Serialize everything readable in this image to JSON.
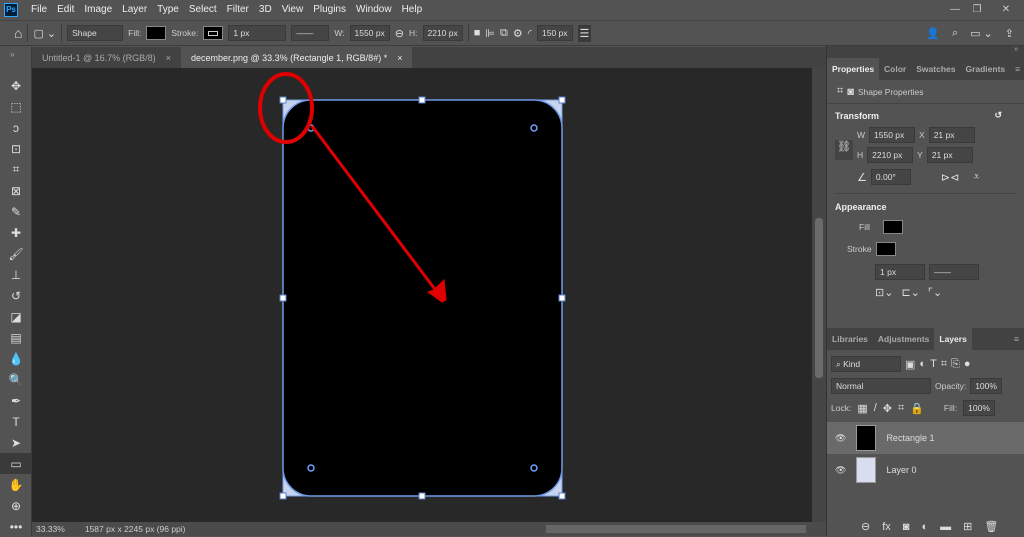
{
  "app": {
    "logo": "Ps",
    "menu": [
      "File",
      "Edit",
      "Image",
      "Layer",
      "Type",
      "Select",
      "Filter",
      "3D",
      "View",
      "Plugins",
      "Window",
      "Help"
    ],
    "window_controls": [
      "minimize",
      "restore",
      "close"
    ]
  },
  "options": {
    "tool_mode": "Shape",
    "fill_label": "Fill:",
    "fill_color": "#000000",
    "stroke_label": "Stroke:",
    "stroke_width": "1 px",
    "w_label": "W:",
    "w_value": "1550 px",
    "h_label": "H:",
    "h_value": "2210 px",
    "radius": "150 px"
  },
  "tabs": [
    {
      "label": "Untitled-1 @ 16.7% (RGB/8)",
      "active": false
    },
    {
      "label": "december.png @ 33.3% (Rectangle 1, RGB/8#) *",
      "active": true
    }
  ],
  "status": {
    "zoom": "33.33%",
    "doc_info": "1587 px x 2245 px (96 ppi)"
  },
  "properties": {
    "tabs": [
      "Properties",
      "Color",
      "Swatches",
      "Gradients"
    ],
    "header": "Shape Properties",
    "transform": {
      "title": "Transform",
      "w_label": "W",
      "w": "1550 px",
      "x_label": "X",
      "x": "21 px",
      "h_label": "H",
      "h": "2210 px",
      "y_label": "Y",
      "y": "21 px",
      "angle": "0.00°"
    },
    "appearance": {
      "title": "Appearance",
      "fill_label": "Fill",
      "stroke_label": "Stroke",
      "stroke_width": "1 px"
    }
  },
  "layers": {
    "tabs": [
      "Libraries",
      "Adjustments",
      "Layers"
    ],
    "filter": "Kind",
    "blend": "Normal",
    "opacity_label": "Opacity:",
    "opacity": "100%",
    "lock_label": "Lock:",
    "fill_label": "Fill:",
    "fill": "100%",
    "items": [
      {
        "name": "Rectangle 1",
        "selected": true
      },
      {
        "name": "Layer 0",
        "selected": false
      }
    ]
  },
  "annotation_color": "#e00000"
}
